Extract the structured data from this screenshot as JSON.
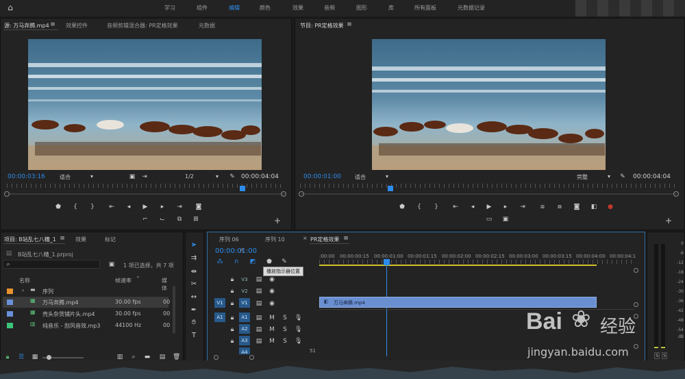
{
  "workspace": {
    "tabs": [
      "学习",
      "组件",
      "编辑",
      "颜色",
      "效果",
      "音频",
      "图形",
      "库",
      "所有面板",
      "元数据记录"
    ],
    "active_index": 2
  },
  "source": {
    "tabs": [
      "源: 万马奔腾.mp4",
      "效果控件",
      "音频剪辑混合器: PR定格效果",
      "元数据"
    ],
    "timecode": "00:00:03:16",
    "fit": "适合",
    "res": "1/2",
    "duration": "00:00:04:04"
  },
  "program": {
    "tab": "节目: PR定格效果",
    "timecode": "00:00:01:00",
    "fit": "适合",
    "res": "完整",
    "duration": "00:00:04:04"
  },
  "project": {
    "tabs": [
      "项目: B站乱七八糟_1",
      "效果",
      "标记"
    ],
    "file": "B站乱七八糟_1.prproj",
    "selection": "1 项已选择，共 7 项",
    "search_placeholder": "",
    "headers": {
      "name": "名称",
      "rate": "帧速率",
      "media": "媒体"
    },
    "items": [
      {
        "name": "序列",
        "rate": "",
        "color": "#e8922e",
        "folder": true
      },
      {
        "name": "万马奔腾.mp4",
        "rate": "30.00 fps",
        "color": "#6b8fd9",
        "extra": "00"
      },
      {
        "name": "壳头杂货铺片头.mp4",
        "rate": "30.00 fps",
        "color": "#6b8fd9",
        "extra": "00"
      },
      {
        "name": "纯音乐 - 刮风音效.mp3",
        "rate": "44100 Hz",
        "color": "#3cc47a",
        "extra": "00"
      }
    ]
  },
  "timeline": {
    "tabs": [
      "序列 06",
      "序列 10",
      "PR定格效果"
    ],
    "timecode": "00:00:01:00",
    "tooltip": "播放指示器位置",
    "ruler": [
      ":00:00",
      "00:00:00:15",
      "00:00:01:00",
      "00:00:01:15",
      "00:00:02:00",
      "00:00:02:15",
      "00:00:03:00",
      "00:00:03:15",
      "00:00:04:00",
      "00:00:04:1"
    ],
    "video_tracks": [
      "V3",
      "V2",
      "V1"
    ],
    "audio_tracks": [
      "A1",
      "A2",
      "A3",
      "A4"
    ],
    "source_v": "V1",
    "source_a": "A1",
    "clip": "万马奔腾.mp4",
    "extra_value": "51"
  },
  "meter": {
    "scale": [
      "0",
      "-6",
      "-12",
      "-18",
      "-24",
      "-30",
      "-36",
      "-42",
      "-48",
      "-54",
      "dB"
    ],
    "solo": [
      "S",
      "S"
    ]
  },
  "watermark": {
    "brand": "Bai",
    "brand2": "经验",
    "url": "jingyan.baidu.com"
  }
}
